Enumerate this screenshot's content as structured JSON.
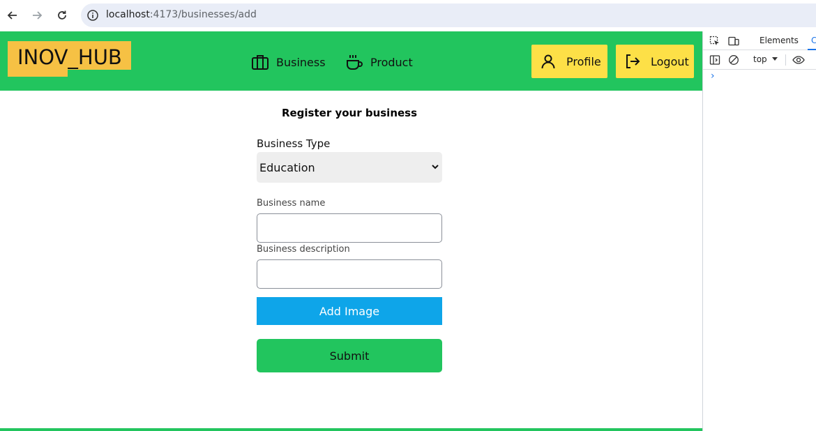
{
  "browser": {
    "url_host": "localhost",
    "url_rest": ":4173/businesses/add"
  },
  "header": {
    "logo_text": "INOV_HUB",
    "nav": [
      {
        "label": "Business",
        "icon": "briefcase-icon"
      },
      {
        "label": "Product",
        "icon": "coffee-cup-icon"
      }
    ],
    "profile_label": "Profile",
    "logout_label": "Logout"
  },
  "form": {
    "title": "Register your business",
    "type_label": "Business Type",
    "type_selected": "Education",
    "name_label": "Business name",
    "name_value": "",
    "description_label": "Business description",
    "description_value": "",
    "add_image_label": "Add Image",
    "submit_label": "Submit"
  },
  "devtools": {
    "tab_elements": "Elements",
    "tab_console": "C",
    "context": "top",
    "prompt": "›"
  },
  "colors": {
    "header_green": "#22c55e",
    "logo_yellow": "#f6c144",
    "button_yellow": "#fde047",
    "add_image_blue": "#0ea5e9"
  }
}
